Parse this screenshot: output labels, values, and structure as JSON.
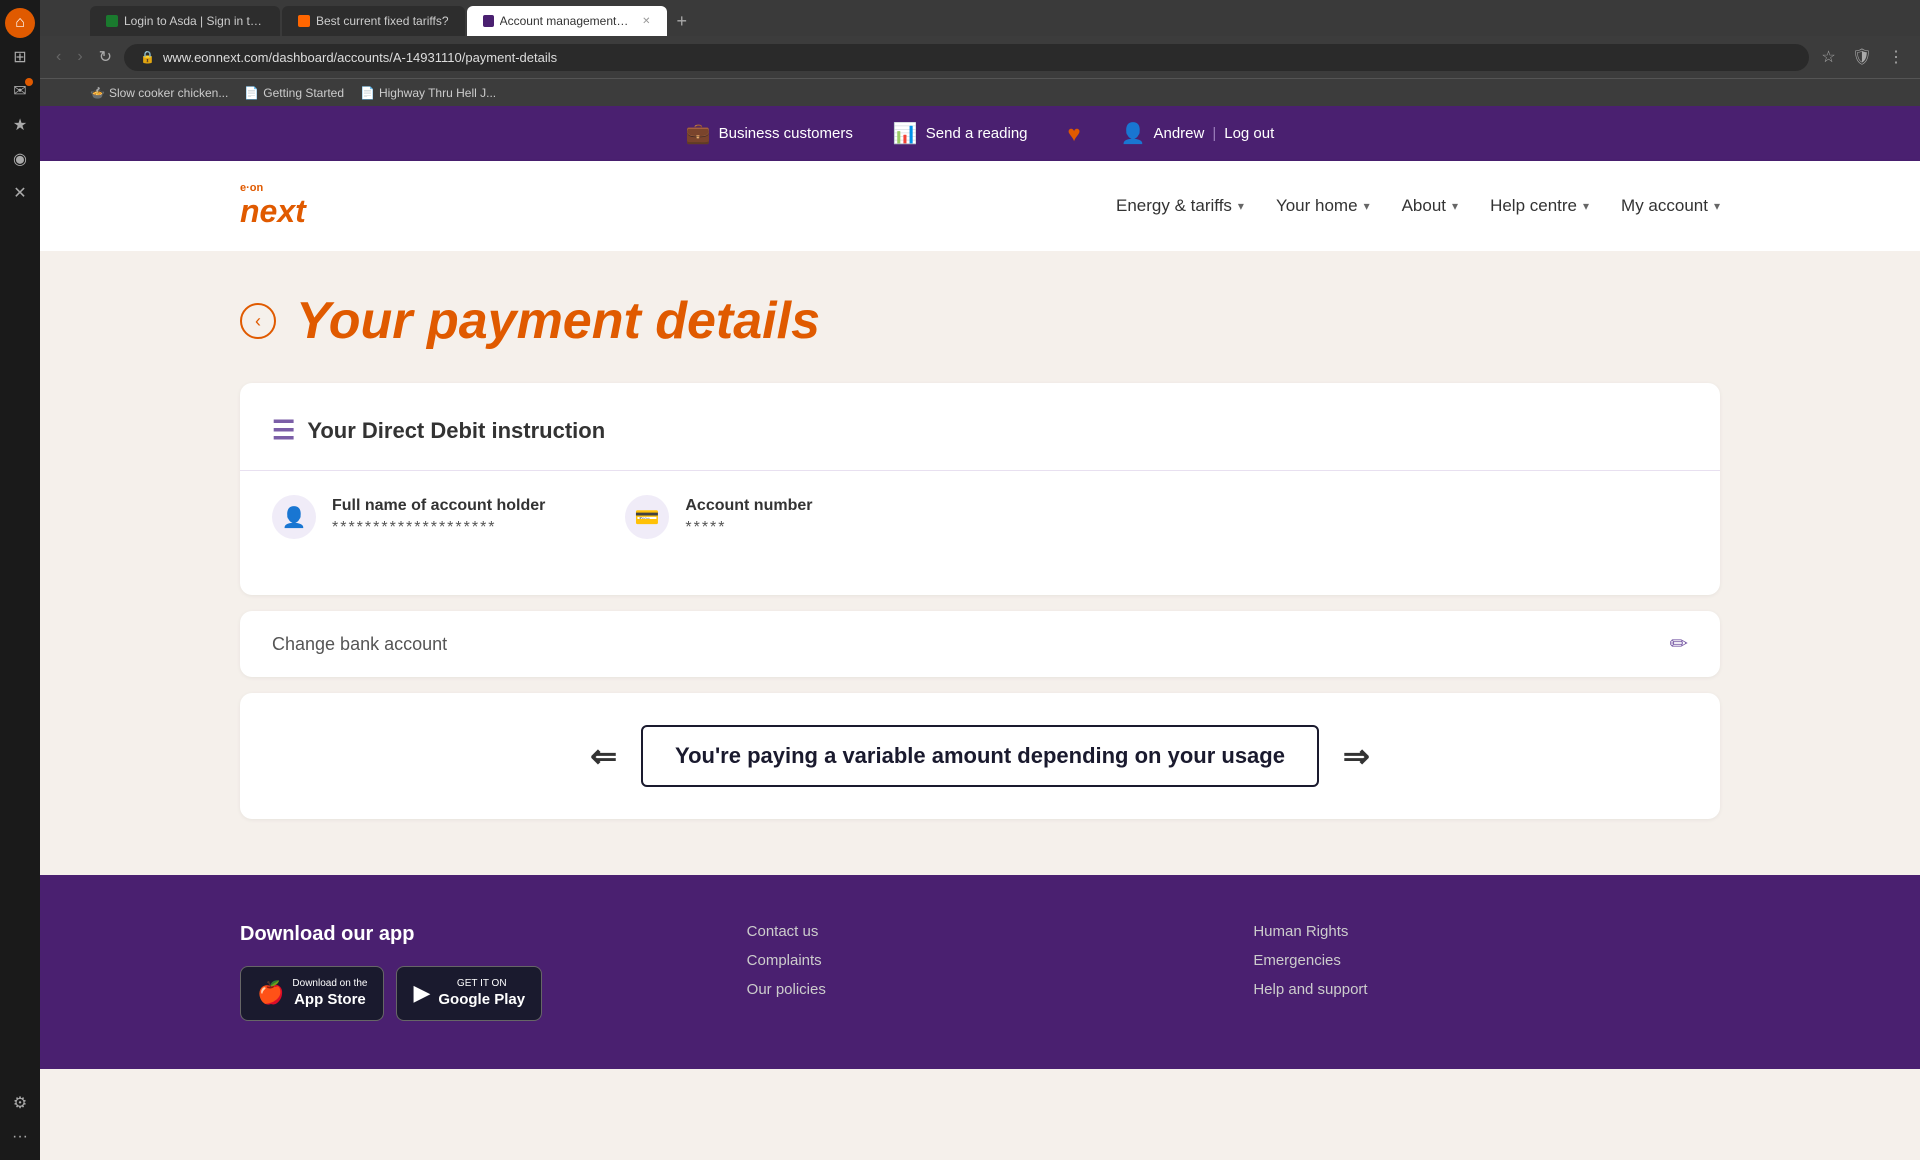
{
  "browser": {
    "tabs": [
      {
        "id": "tab-asda",
        "label": "Login to Asda | Sign in to...",
        "favicon_color": "#1a7a2e",
        "active": false
      },
      {
        "id": "tab-fixed",
        "label": "Best current fixed tariffs?",
        "favicon_color": "#ff6600",
        "active": false
      },
      {
        "id": "tab-account",
        "label": "Account management | Pa",
        "favicon_color": "#4a2070",
        "active": true
      }
    ],
    "address": "www.eonnext.com/dashboard/accounts/A-14931110/payment-details",
    "bookmarks": [
      {
        "label": "Slow cooker chicken...",
        "id": "bm-1"
      },
      {
        "label": "Getting Started",
        "id": "bm-2"
      },
      {
        "label": "Highway Thru Hell J...",
        "id": "bm-3"
      }
    ]
  },
  "utility_bar": {
    "business_label": "Business customers",
    "reading_label": "Send a reading",
    "user_name": "Andrew",
    "logout_label": "Log out",
    "separator": "|"
  },
  "nav": {
    "logo_eon": "e·on",
    "logo_next": "next",
    "items": [
      {
        "id": "energy-tariffs",
        "label": "Energy & tariffs",
        "has_chevron": true
      },
      {
        "id": "your-home",
        "label": "Your home",
        "has_chevron": true
      },
      {
        "id": "about",
        "label": "About",
        "has_chevron": true
      },
      {
        "id": "help-centre",
        "label": "Help centre",
        "has_chevron": true
      },
      {
        "id": "my-account",
        "label": "My account",
        "has_chevron": true
      }
    ]
  },
  "page": {
    "title": "Your payment details",
    "back_button_label": "‹"
  },
  "direct_debit": {
    "title": "Your Direct Debit instruction",
    "account_holder_label": "Full name of account holder",
    "account_holder_value": "********************",
    "account_number_label": "Account number",
    "account_number_value": "*****"
  },
  "change_bank": {
    "label": "Change bank account"
  },
  "variable_payment": {
    "text": "You're paying a variable amount depending on your usage"
  },
  "footer": {
    "app_section": {
      "title": "Download our app",
      "app_store_label": "Download on the",
      "app_store_name": "App Store",
      "play_store_label": "GET IT ON",
      "play_store_name": "Google Play"
    },
    "links_col1": [
      {
        "id": "contact-us",
        "label": "Contact us"
      },
      {
        "id": "complaints",
        "label": "Complaints"
      },
      {
        "id": "our-policies",
        "label": "Our policies"
      }
    ],
    "links_col2": [
      {
        "id": "human-rights",
        "label": "Human Rights"
      },
      {
        "id": "emergencies",
        "label": "Emergencies"
      },
      {
        "id": "help-support",
        "label": "Help and support"
      }
    ]
  },
  "colors": {
    "brand_orange": "#e05a00",
    "brand_purple": "#4a2070",
    "brand_light_purple": "#7b5ea7"
  }
}
